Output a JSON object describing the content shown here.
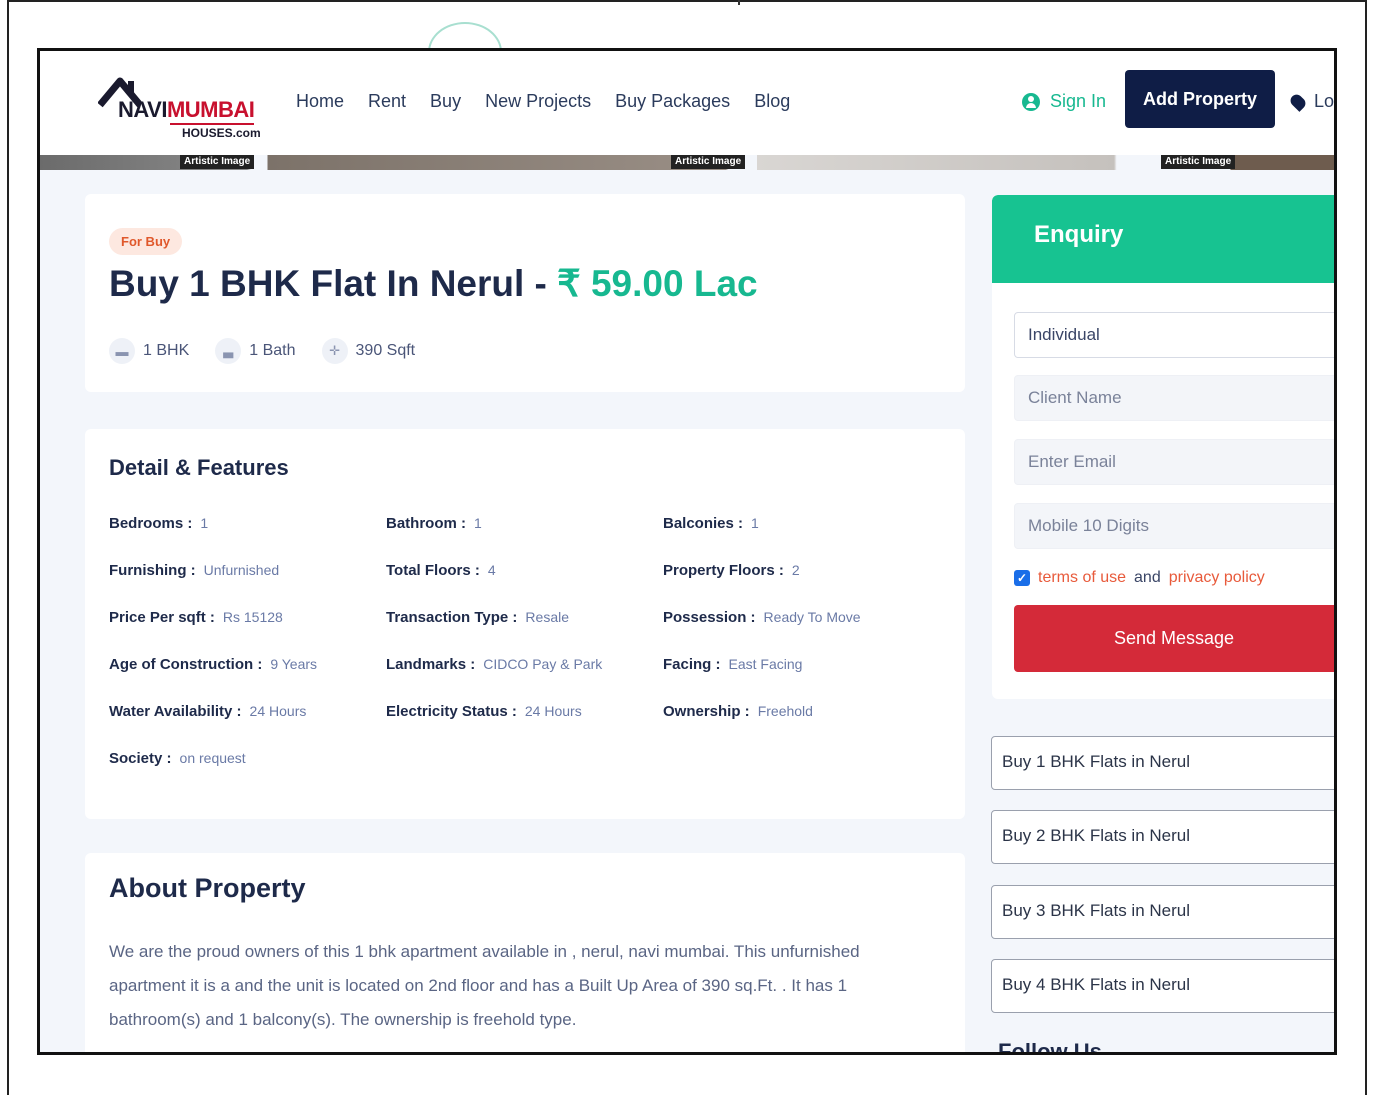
{
  "header": {
    "logo": {
      "navi": "NAVI",
      "mumbai": "MUMBAI",
      "houses": "HOUSES.com"
    },
    "nav": [
      "Home",
      "Rent",
      "Buy",
      "New Projects",
      "Buy Packages",
      "Blog"
    ],
    "signin_label": "Sign In",
    "add_property_label": "Add Property",
    "location_label": "Lo"
  },
  "banner": {
    "artistic_label": "Artistic Image"
  },
  "listing": {
    "badge": "For Buy",
    "title": "Buy 1 BHK Flat In Nerul - ",
    "price": "₹ 59.00 Lac",
    "specs": [
      {
        "icon": "bed-icon",
        "label": "1 BHK"
      },
      {
        "icon": "bath-icon",
        "label": "1 Bath"
      },
      {
        "icon": "area-icon",
        "label": "390 Sqft"
      }
    ]
  },
  "details": {
    "heading": "Detail & Features",
    "features": [
      {
        "key": "Bedrooms :",
        "value": "1"
      },
      {
        "key": "Bathroom :",
        "value": "1"
      },
      {
        "key": "Balconies :",
        "value": "1"
      },
      {
        "key": "Furnishing :",
        "value": "Unfurnished"
      },
      {
        "key": "Total Floors :",
        "value": "4"
      },
      {
        "key": "Property Floors :",
        "value": "2"
      },
      {
        "key": "Price Per sqft :",
        "value": "Rs 15128"
      },
      {
        "key": "Transaction Type :",
        "value": "Resale"
      },
      {
        "key": "Possession :",
        "value": "Ready To Move"
      },
      {
        "key": "Age of Construction :",
        "value": "9 Years"
      },
      {
        "key": "Landmarks :",
        "value": "CIDCO Pay & Park"
      },
      {
        "key": "Facing :",
        "value": "East Facing"
      },
      {
        "key": "Water Availability :",
        "value": "24 Hours"
      },
      {
        "key": "Electricity Status :",
        "value": "24 Hours"
      },
      {
        "key": "Ownership :",
        "value": "Freehold"
      },
      {
        "key": "Society :",
        "value": "on request"
      }
    ]
  },
  "about": {
    "heading": "About Property",
    "text": "We are the proud owners of this 1 bhk apartment available in , nerul, navi mumbai. This unfurnished apartment it is a and the unit is located on 2nd floor and has a Built Up Area of 390 sq.Ft. . It has 1 bathroom(s) and 1 balcony(s). The ownership is freehold type."
  },
  "enquiry": {
    "heading": "Enquiry",
    "type_value": "Individual",
    "name_placeholder": "Client Name",
    "email_placeholder": "Enter Email",
    "mobile_placeholder": "Mobile 10 Digits",
    "terms_link": "terms of use",
    "and": "and",
    "privacy_link": "privacy policy",
    "send_label": "Send Message"
  },
  "related_links": [
    "Buy 1 BHK Flats in Nerul",
    "Buy 2 BHK Flats in Nerul",
    "Buy 3 BHK Flats in Nerul",
    "Buy 4 BHK Flats in Nerul"
  ],
  "follow_heading": "Follow Us",
  "colors": {
    "accent_green": "#17b890",
    "navy": "#0f1d46",
    "send_red": "#d42a39",
    "badge_orange": "#e0582b"
  }
}
